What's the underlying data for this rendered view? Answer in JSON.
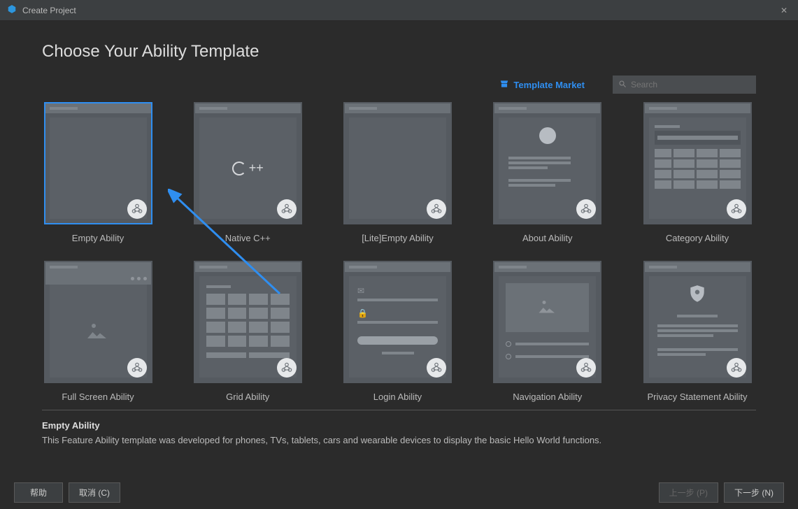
{
  "window": {
    "title": "Create Project"
  },
  "heading": "Choose Your Ability Template",
  "toolbar": {
    "market_label": "Template Market"
  },
  "search": {
    "placeholder": "Search"
  },
  "templates": [
    {
      "label": "Empty Ability",
      "selected": true,
      "kind": "empty"
    },
    {
      "label": "Native C++",
      "selected": false,
      "kind": "cpp"
    },
    {
      "label": "[Lite]Empty Ability",
      "selected": false,
      "kind": "empty"
    },
    {
      "label": "About Ability",
      "selected": false,
      "kind": "about"
    },
    {
      "label": "Category Ability",
      "selected": false,
      "kind": "category"
    },
    {
      "label": "Full Screen Ability",
      "selected": false,
      "kind": "fullscreen"
    },
    {
      "label": "Grid Ability",
      "selected": false,
      "kind": "grid"
    },
    {
      "label": "Login Ability",
      "selected": false,
      "kind": "login"
    },
    {
      "label": "Navigation Ability",
      "selected": false,
      "kind": "nav"
    },
    {
      "label": "Privacy Statement Ability",
      "selected": false,
      "kind": "privacy"
    }
  ],
  "selected": {
    "title": "Empty Ability",
    "description": "This Feature Ability template was developed for phones, TVs, tablets, cars and wearable devices to display the basic Hello World functions."
  },
  "footer": {
    "help": "帮助",
    "cancel": "取消 (C)",
    "prev": "上一步 (P)",
    "next": "下一步 (N)"
  },
  "cpp_label": "C++"
}
